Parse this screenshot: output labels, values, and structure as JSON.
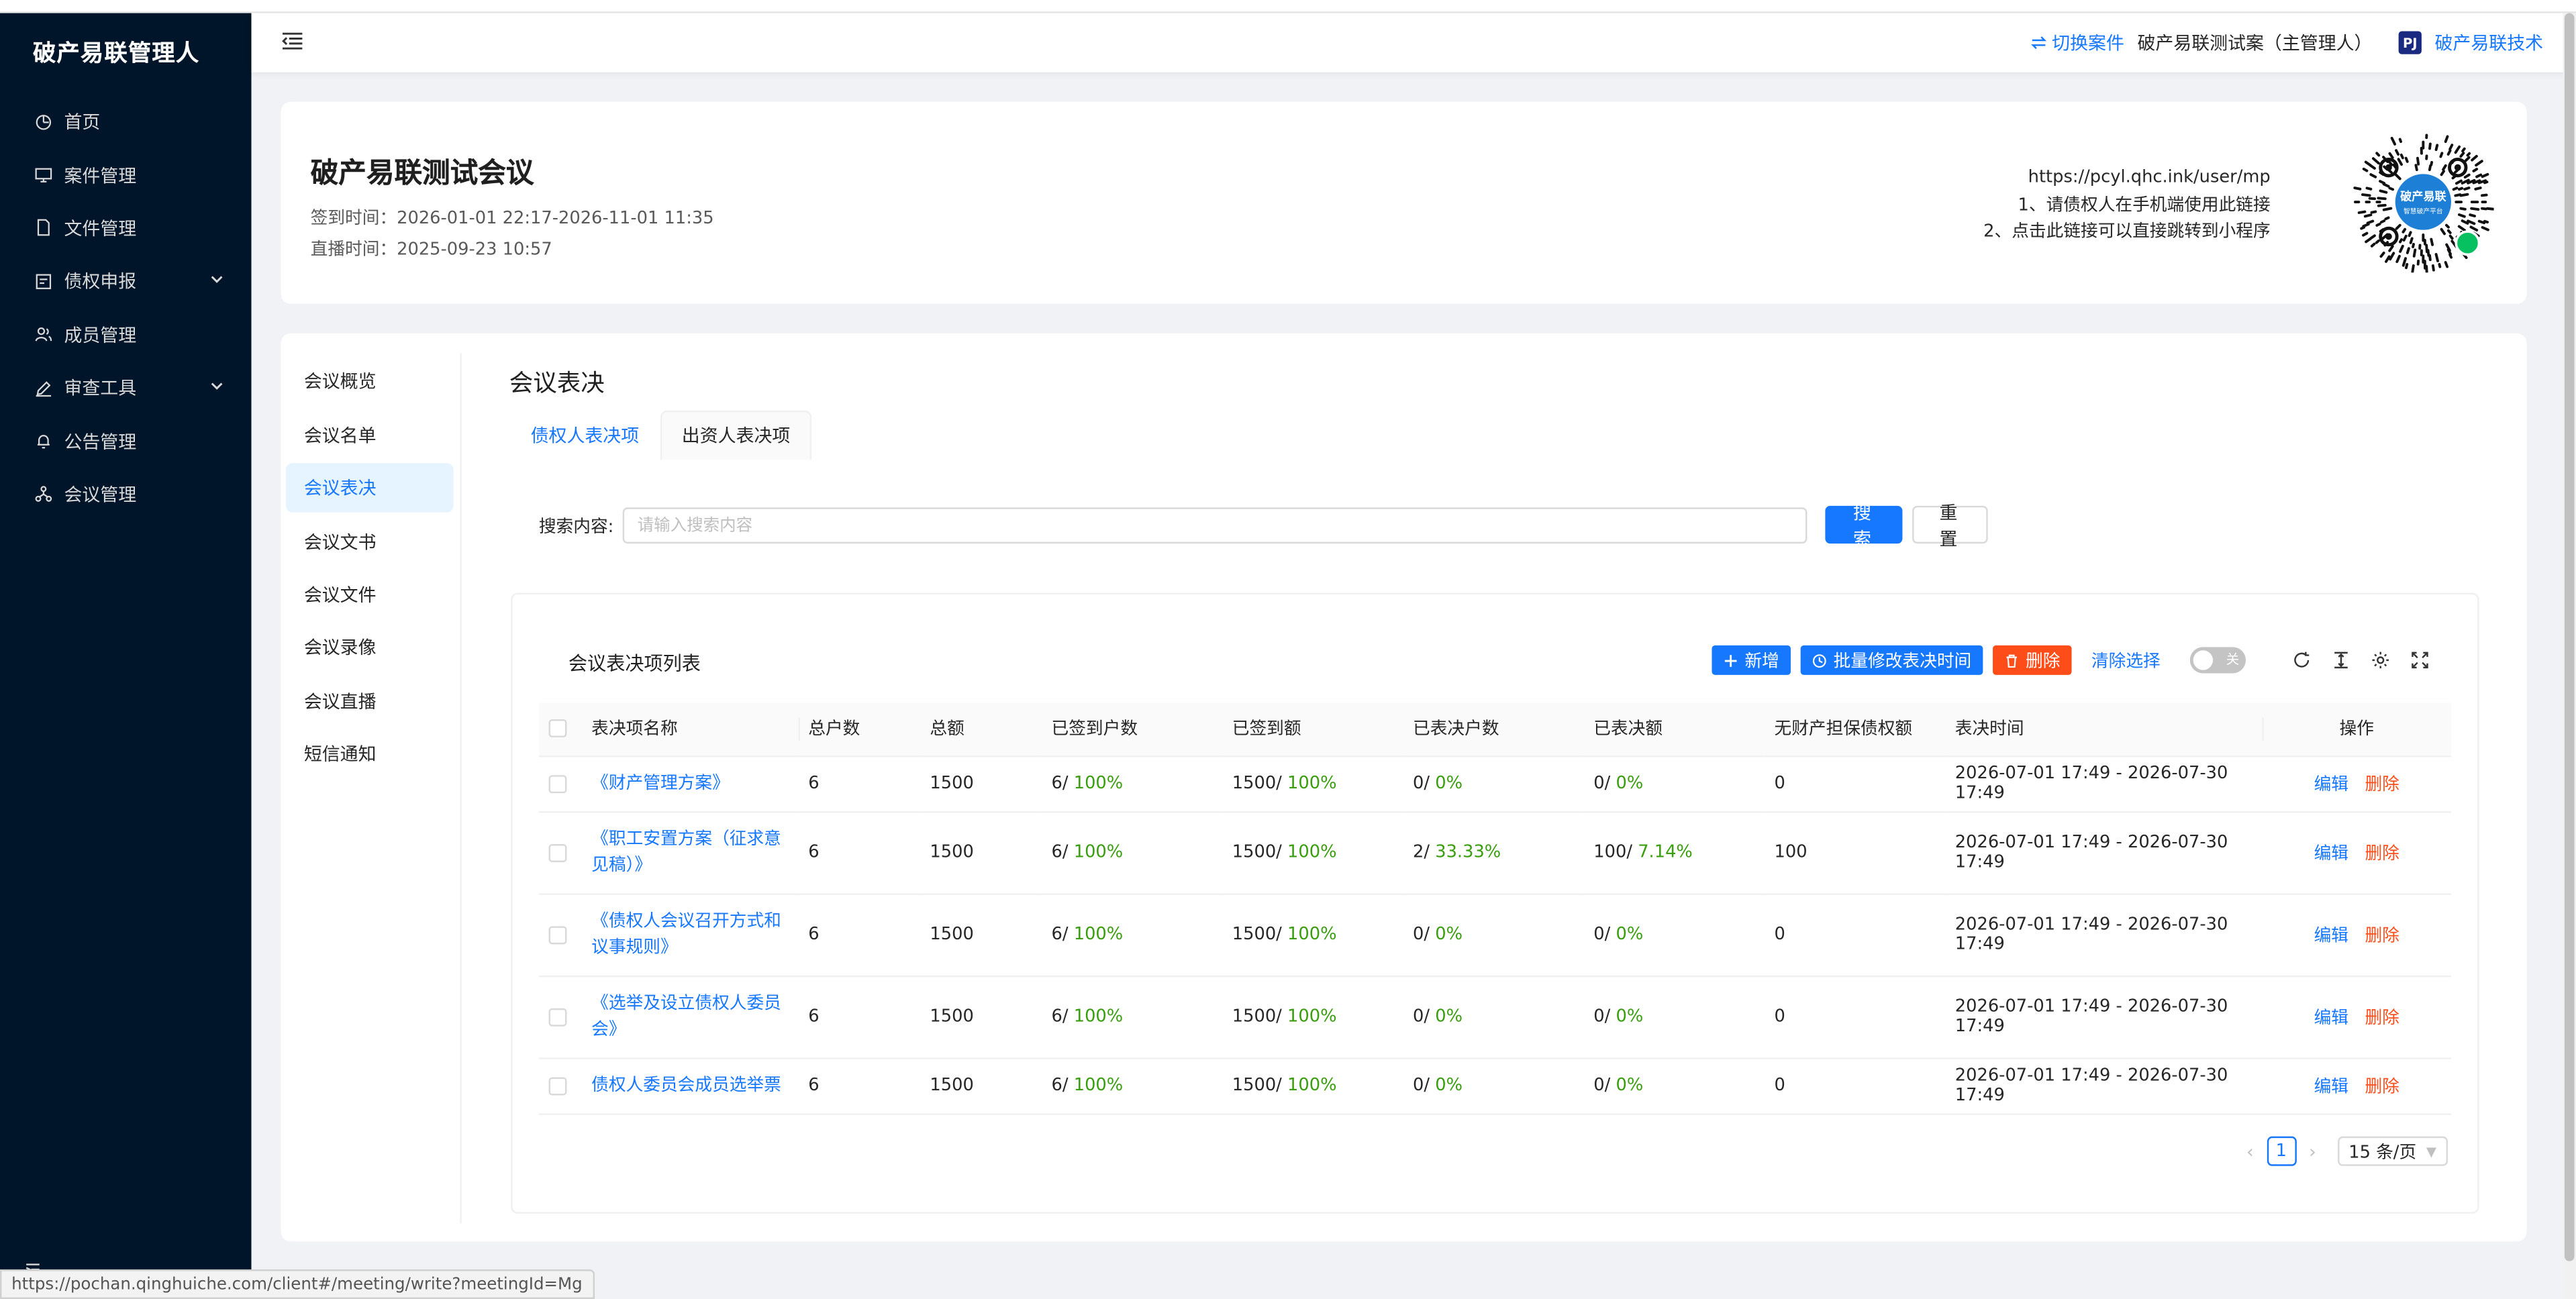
{
  "sidebar": {
    "brand": "破产易联管理人",
    "items": [
      {
        "label": "首页",
        "icon": "dashboard-icon"
      },
      {
        "label": "案件管理",
        "icon": "monitor-icon"
      },
      {
        "label": "文件管理",
        "icon": "file-icon"
      },
      {
        "label": "债权申报",
        "icon": "form-icon",
        "expandable": true
      },
      {
        "label": "成员管理",
        "icon": "users-icon"
      },
      {
        "label": "审查工具",
        "icon": "edit-icon",
        "expandable": true
      },
      {
        "label": "公告管理",
        "icon": "bell-icon"
      },
      {
        "label": "会议管理",
        "icon": "cluster-icon"
      }
    ]
  },
  "header": {
    "switch_case": "切换案件",
    "case_name": "破产易联测试案（主管理人）",
    "tech_logo": "PJ",
    "tech_name": "破产易联技术"
  },
  "meeting": {
    "title": "破产易联测试会议",
    "checkin_time": "签到时间：2026-01-01 22:17-2026-11-01 11:35",
    "live_time": "直播时间：2025-09-23 10:57",
    "link_url": "https://pcyl.qhc.ink/user/mp",
    "link_tip1": "1、请债权人在手机端使用此链接",
    "link_tip2": "2、点击此链接可以直接跳转到小程序",
    "qr_center_line1": "破产易联",
    "qr_center_line2": "智慧破产平台"
  },
  "subnav": {
    "items": [
      "会议概览",
      "会议名单",
      "会议表决",
      "会议文书",
      "会议文件",
      "会议录像",
      "会议直播",
      "短信通知"
    ],
    "active_index": 2
  },
  "vote": {
    "section_title": "会议表决",
    "tabs": [
      "债权人表决项",
      "出资人表决项"
    ],
    "active_tab": 0,
    "search_label": "搜索内容:",
    "search_placeholder": "请输入搜索内容",
    "search_value": "",
    "search_button": "搜 索",
    "reset_button": "重 置",
    "list_title": "会议表决项列表",
    "add_button": "新增",
    "batch_button": "批量修改表决时间",
    "delete_button": "删除",
    "clear_link": "清除选择",
    "toggle_label": "关",
    "columns": [
      "表决项名称",
      "总户数",
      "总额",
      "已签到户数",
      "已签到额",
      "已表决户数",
      "已表决额",
      "无财产担保债权额",
      "表决时间",
      "操作"
    ],
    "rows": [
      {
        "name": "《财产管理方案》",
        "total_households": "6",
        "total_amount": "1500",
        "checkin_count": "6/",
        "checkin_count_pct": "100%",
        "checkin_amount": "1500/",
        "checkin_amount_pct": "100%",
        "voted_count": "0/",
        "voted_count_pct": "0%",
        "voted_amount": "0/",
        "voted_amount_pct": "0%",
        "unsecured": "0",
        "vote_time": "2026-07-01 17:49 - 2026-07-30 17:49",
        "edit": "编辑",
        "delete": "删除"
      },
      {
        "name": "《职工安置方案（征求意见稿）》",
        "total_households": "6",
        "total_amount": "1500",
        "checkin_count": "6/",
        "checkin_count_pct": "100%",
        "checkin_amount": "1500/",
        "checkin_amount_pct": "100%",
        "voted_count": "2/",
        "voted_count_pct": "33.33%",
        "voted_amount": "100/",
        "voted_amount_pct": "7.14%",
        "unsecured": "100",
        "vote_time": "2026-07-01 17:49 - 2026-07-30 17:49",
        "edit": "编辑",
        "delete": "删除"
      },
      {
        "name": "《债权人会议召开方式和议事规则》",
        "total_households": "6",
        "total_amount": "1500",
        "checkin_count": "6/",
        "checkin_count_pct": "100%",
        "checkin_amount": "1500/",
        "checkin_amount_pct": "100%",
        "voted_count": "0/",
        "voted_count_pct": "0%",
        "voted_amount": "0/",
        "voted_amount_pct": "0%",
        "unsecured": "0",
        "vote_time": "2026-07-01 17:49 - 2026-07-30 17:49",
        "edit": "编辑",
        "delete": "删除"
      },
      {
        "name": "《选举及设立债权人委员会》",
        "total_households": "6",
        "total_amount": "1500",
        "checkin_count": "6/",
        "checkin_count_pct": "100%",
        "checkin_amount": "1500/",
        "checkin_amount_pct": "100%",
        "voted_count": "0/",
        "voted_count_pct": "0%",
        "voted_amount": "0/",
        "voted_amount_pct": "0%",
        "unsecured": "0",
        "vote_time": "2026-07-01 17:49 - 2026-07-30 17:49",
        "edit": "编辑",
        "delete": "删除"
      },
      {
        "name": "债权人委员会成员选举票",
        "total_households": "6",
        "total_amount": "1500",
        "checkin_count": "6/",
        "checkin_count_pct": "100%",
        "checkin_amount": "1500/",
        "checkin_amount_pct": "100%",
        "voted_count": "0/",
        "voted_count_pct": "0%",
        "voted_amount": "0/",
        "voted_amount_pct": "0%",
        "unsecured": "0",
        "vote_time": "2026-07-01 17:49 - 2026-07-30 17:49",
        "edit": "编辑",
        "delete": "删除"
      }
    ],
    "pagination": {
      "current_page": "1",
      "page_size": "15 条/页"
    }
  },
  "status_bar": {
    "url": "https://pochan.qinghuiche.com/client#/meeting/write?meetingId=Mg"
  },
  "colors": {
    "primary": "#1677ff",
    "danger": "#ff4d1a",
    "success": "#389e0d",
    "sidebar_bg": "#001529"
  }
}
